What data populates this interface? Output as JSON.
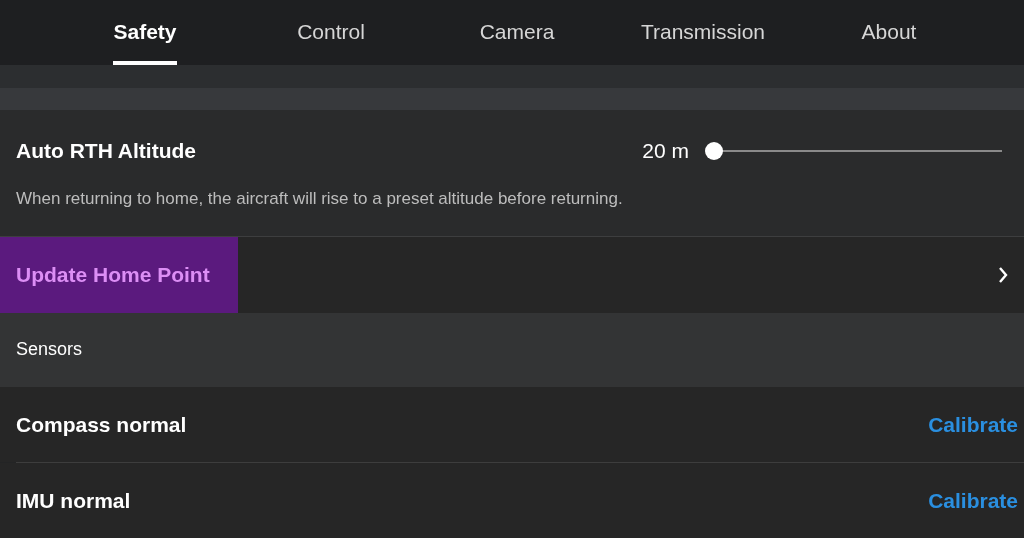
{
  "tabs": [
    {
      "label": "Safety",
      "selected": true
    },
    {
      "label": "Control",
      "selected": false
    },
    {
      "label": "Camera",
      "selected": false
    },
    {
      "label": "Transmission",
      "selected": false
    },
    {
      "label": "About",
      "selected": false
    }
  ],
  "altitude": {
    "label": "Auto RTH Altitude",
    "reading": "20 m",
    "level": 0,
    "description": "When returning to home, the aircraft will rise to a preset altitude before returning."
  },
  "home_point": {
    "label": "Update Home Point",
    "highlighted": true
  },
  "sensors": {
    "title": "Sensors",
    "items": [
      {
        "label": "Compass normal",
        "action": "Calibrate"
      },
      {
        "label": "IMU normal",
        "action": "Calibrate"
      }
    ]
  }
}
